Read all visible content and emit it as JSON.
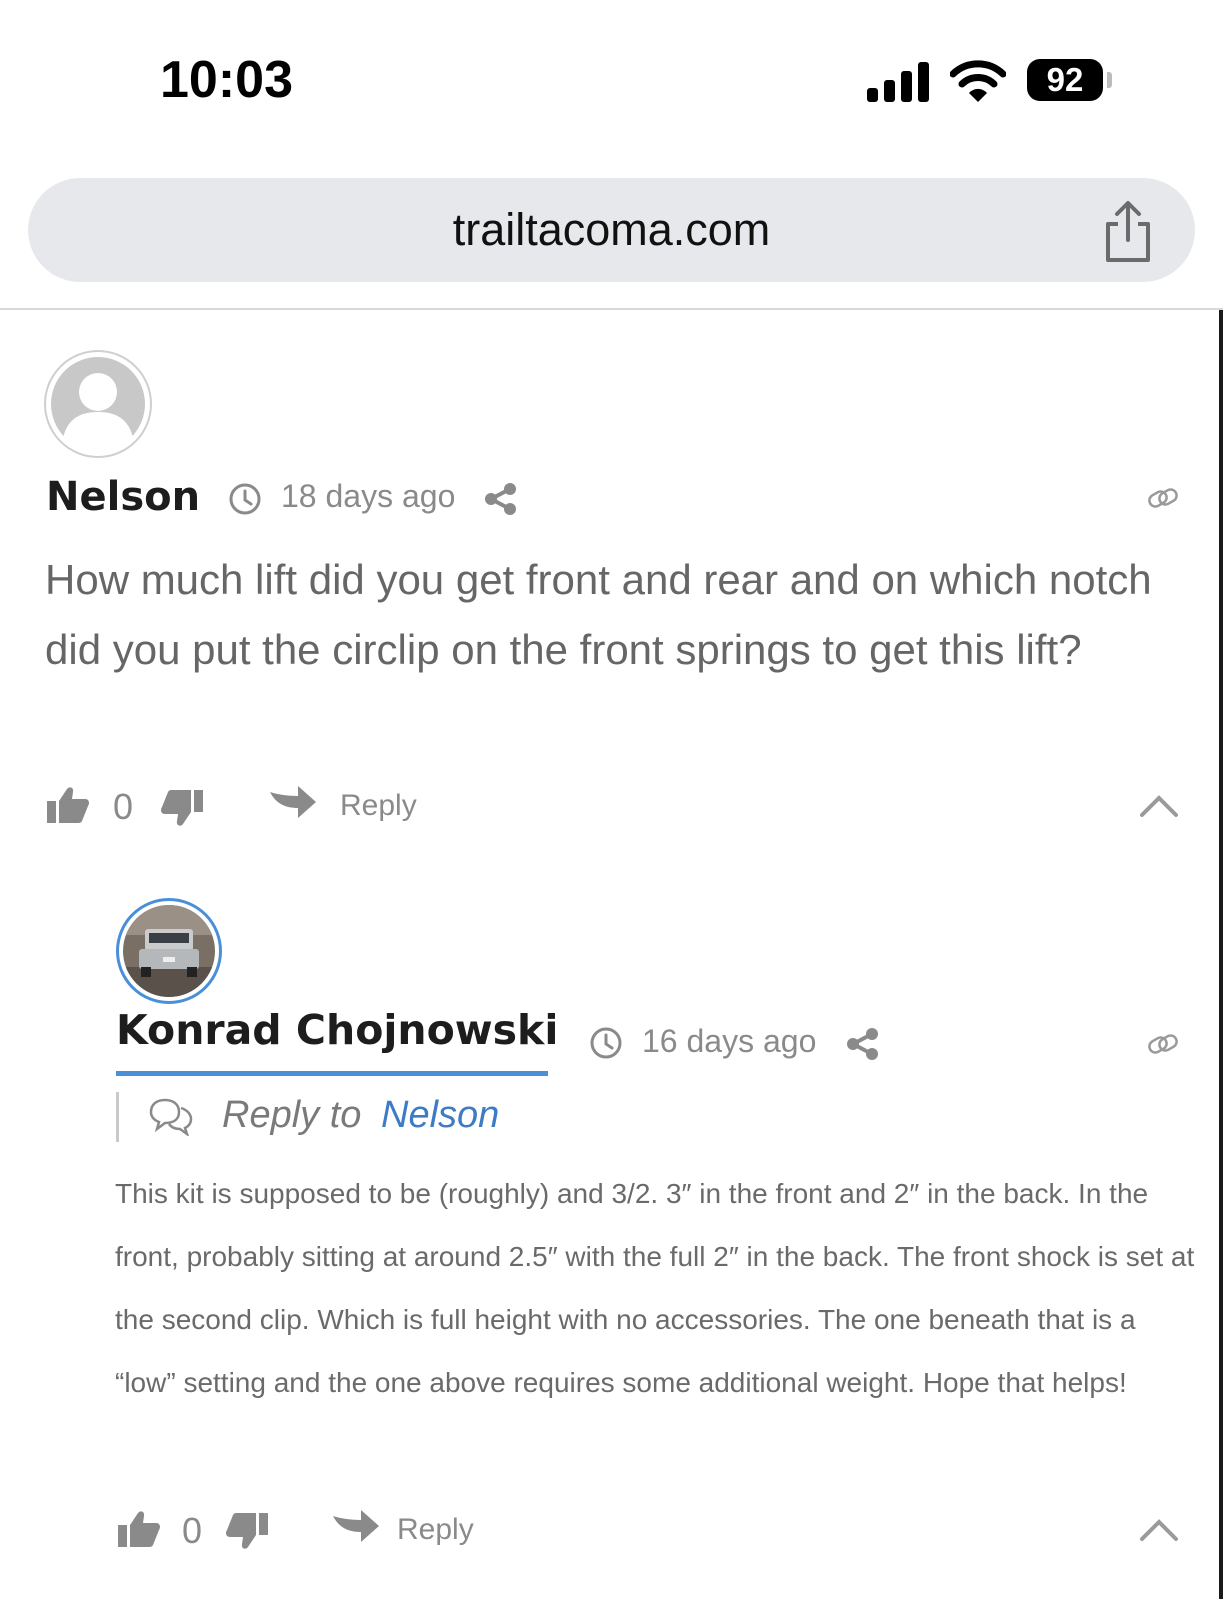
{
  "status_bar": {
    "time": "10:03",
    "battery": "92"
  },
  "browser": {
    "url": "trailtacoma.com"
  },
  "comments": [
    {
      "author": "Nelson",
      "time_ago": "18 days ago",
      "body": "How much lift did you get front and rear and on which notch did you put the circlip on the front springs to get this lift?",
      "votes": "0",
      "reply_label": "Reply"
    },
    {
      "author": "Konrad Chojnowski",
      "time_ago": "16 days ago",
      "reply_to_label": "Reply to",
      "reply_to_name": "Nelson",
      "body": "This kit is supposed to be (roughly) and 3/2. 3″ in the front and 2″ in the back. In the front, probably sitting at around 2.5″ with the full 2″ in the back. The front shock is set at the second clip. Which is full height with no accessories. The one beneath that is a “low” setting and the one above requires some additional weight. Hope that helps!",
      "votes": "0",
      "reply_label": "Reply"
    }
  ]
}
